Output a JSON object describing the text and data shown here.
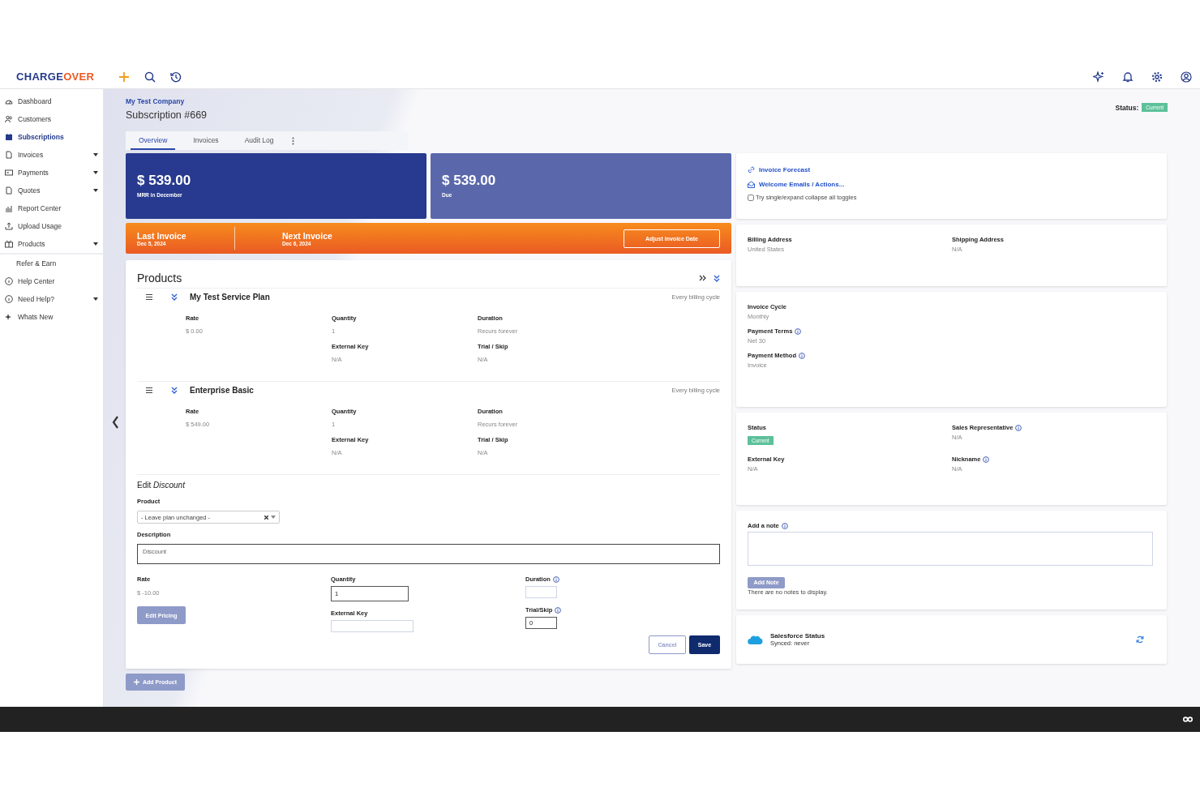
{
  "header": {
    "logo": [
      "CHARGE",
      "OVER"
    ]
  },
  "sidebar": {
    "items": [
      {
        "label": "Dashboard",
        "selected": false,
        "has_menu": false
      },
      {
        "label": "Customers",
        "selected": false,
        "has_menu": false
      },
      {
        "label": "Subscriptions",
        "selected": true,
        "has_menu": false
      },
      {
        "label": "Invoices",
        "selected": false,
        "has_menu": true
      },
      {
        "label": "Payments",
        "selected": false,
        "has_menu": true
      },
      {
        "label": "Quotes",
        "selected": false,
        "has_menu": true
      },
      {
        "label": "Report Center",
        "selected": false,
        "has_menu": false
      },
      {
        "label": "Upload Usage",
        "selected": false,
        "has_menu": false
      },
      {
        "label": "Products",
        "selected": false,
        "has_menu": true
      },
      {
        "label": "Refer & Earn",
        "selected": false,
        "has_menu": false
      },
      {
        "label": "Help Center",
        "selected": false,
        "has_menu": false
      },
      {
        "label": "Need Help?",
        "selected": false,
        "has_menu": true
      },
      {
        "label": "Whats New",
        "selected": false,
        "has_menu": false
      }
    ]
  },
  "page": {
    "company": "My Test Company",
    "title": "Subscription #669",
    "status_label": "Status:",
    "status": "Current"
  },
  "tabs": [
    {
      "label": "Overview",
      "selected": true
    },
    {
      "label": "Invoices",
      "selected": false
    },
    {
      "label": "Audit Log",
      "selected": false
    }
  ],
  "summary": [
    {
      "amount": "$ 539.00",
      "label": "MRR in December",
      "color": "#273a8f"
    },
    {
      "amount": "$ 539.00",
      "label": "Due",
      "color": "#5a68ab"
    }
  ],
  "invoice_bar": {
    "last_label": "Last Invoice",
    "last_date": "Dec 5, 2024",
    "next_label": "Next Invoice",
    "next_date": "Dec 6, 2024",
    "button": "Adjust Invoice Date"
  },
  "products": {
    "title": "Products",
    "items": [
      {
        "name": "My Test Service Plan",
        "cycle": "Every billing cycle",
        "columns": [
          [
            {
              "label": "Rate",
              "value": "$ 0.00"
            }
          ],
          [
            {
              "label": "Quantity",
              "value": "1"
            },
            {
              "label": "External Key",
              "value": "N/A"
            }
          ],
          [
            {
              "label": "Duration",
              "value": "Recurs forever"
            },
            {
              "label": "Trial / Skip",
              "value": "N/A"
            }
          ]
        ]
      },
      {
        "name": "Enterprise Basic",
        "cycle": "Every billing cycle",
        "columns": [
          [
            {
              "label": "Rate",
              "value": "$ 549.00"
            }
          ],
          [
            {
              "label": "Quantity",
              "value": "1"
            },
            {
              "label": "External Key",
              "value": "N/A"
            }
          ],
          [
            {
              "label": "Duration",
              "value": "Recurs forever"
            },
            {
              "label": "Trial / Skip",
              "value": "N/A"
            }
          ]
        ]
      }
    ],
    "edit": {
      "title": "Edit *Discount*",
      "product_label": "Product",
      "product_value": "- Leave plan unchanged -",
      "description_label": "Description",
      "description_value": "Discount",
      "rate_label": "Rate",
      "rate_value": "$ -10.00",
      "edit_pricing": "Edit Pricing",
      "quantity_label": "Quantity",
      "quantity_value": "1",
      "external_key_label": "External Key",
      "duration_label": "Duration",
      "trial_label": "Trial/Skip",
      "trial_value": "0",
      "cancel": "Cancel",
      "save": "Save"
    },
    "add_product": "Add Product"
  },
  "links": [
    "Invoice Forecast",
    "Welcome Emails / Actions..."
  ],
  "toggle": {
    "label": "Try single/expand collapse all toggles",
    "checked": false
  },
  "address": [
    {
      "label": "Billing Address",
      "value": "United States"
    },
    {
      "label": "Shipping Address",
      "value": "N/A"
    }
  ],
  "terms": [
    {
      "label": "Invoice Cycle",
      "value": "Monthly",
      "info": false
    },
    {
      "label": "Payment Terms",
      "value": "Net 30",
      "info": true
    },
    {
      "label": "Payment Method",
      "value": "Invoice",
      "info": true
    }
  ],
  "details": [
    {
      "label": "Status",
      "value": "Current",
      "kind": "badge",
      "info": false
    },
    {
      "label": "Sales Representative",
      "value": "N/A",
      "kind": "text",
      "info": true
    },
    {
      "label": "External Key",
      "value": "N/A",
      "kind": "text",
      "info": false
    },
    {
      "label": "Nickname",
      "value": "N/A",
      "kind": "text",
      "info": true
    }
  ],
  "notes": {
    "label": "Add a note",
    "button": "Add Note",
    "empty": "There are no notes to display."
  },
  "salesforce": {
    "title": "Salesforce Status",
    "status": "Synced: never"
  }
}
